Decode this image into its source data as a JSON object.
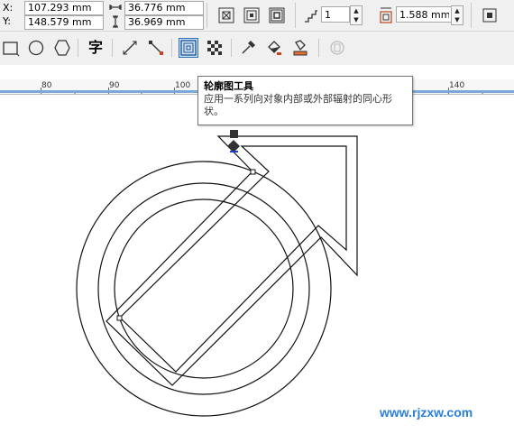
{
  "property_bar": {
    "x_label": "X:",
    "y_label": "Y:",
    "x_value": "107.293 mm",
    "y_value": "148.579 mm",
    "width_value": "36.776 mm",
    "height_value": "36.969 mm",
    "steps_value": "1",
    "offset_value": "1.588 mm"
  },
  "ruler": {
    "labels": [
      "80",
      "90",
      "100",
      "140"
    ]
  },
  "tooltip": {
    "title": "轮廓图工具",
    "body": "应用一系列向对象内部或外部辐射的同心形状。"
  },
  "watermark": "www.rjzxw.com",
  "toolbar": {
    "text_tool_glyph": "字"
  },
  "colors": {
    "accent": "#2b6fb8",
    "watermark": "#2a7fd8",
    "marker_fill": "#333333"
  }
}
